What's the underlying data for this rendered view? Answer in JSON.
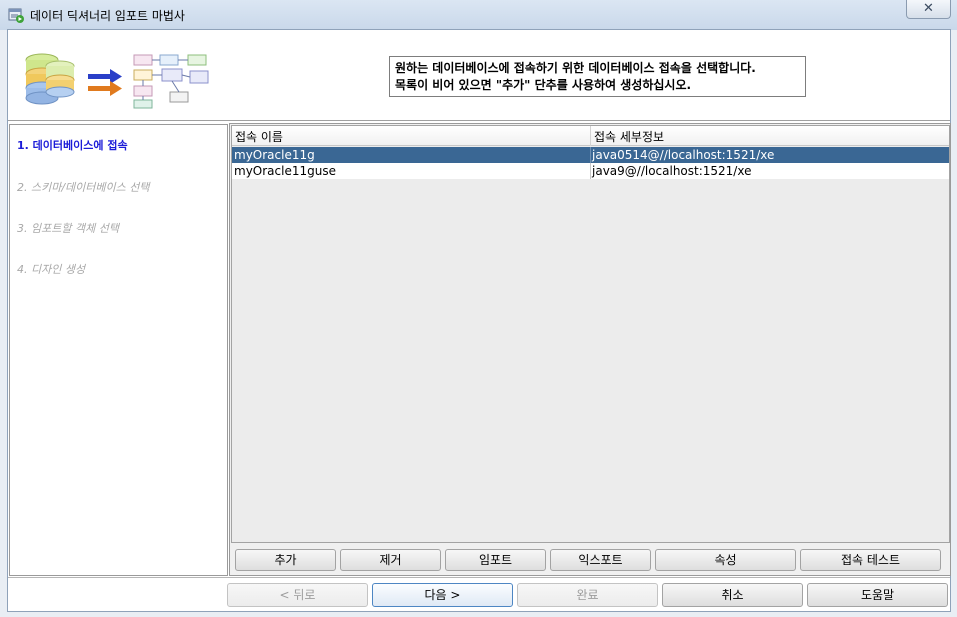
{
  "window": {
    "title": "데이터 딕셔너리 임포트 마법사",
    "close_glyph": "✕"
  },
  "header": {
    "message_line1": "원하는 데이터베이스에 접속하기 위한 데이터베이스 접속을 선택합니다.",
    "message_line2": "목록이 비어 있으면 \"추가\" 단추를 사용하여 생성하십시오."
  },
  "steps": [
    {
      "label": "1. 데이터베이스에 접속",
      "state": "active"
    },
    {
      "label": "2. 스키마/데이터베이스 선택",
      "state": "disabled"
    },
    {
      "label": "3. 임포트할 객체 선택",
      "state": "disabled"
    },
    {
      "label": "4. 디자인 생성",
      "state": "disabled"
    }
  ],
  "table": {
    "columns": [
      "접속 이름",
      "접속 세부정보"
    ],
    "rows": [
      {
        "name": "myOracle11g",
        "details": "java0514@//localhost:1521/xe",
        "selected": true
      },
      {
        "name": "myOracle11guse",
        "details": "java9@//localhost:1521/xe",
        "selected": false
      }
    ]
  },
  "table_buttons": {
    "add": "추가",
    "remove": "제거",
    "import": "임포트",
    "export": "익스포트",
    "properties": "속성",
    "test_connection": "접속 테스트"
  },
  "nav_buttons": {
    "back": "< 뒤로",
    "next": "다음 >",
    "finish": "완료",
    "cancel": "취소",
    "help": "도움말"
  },
  "colors": {
    "selected_row": "#3a6794",
    "active_step": "#1b1bd8",
    "disabled_text": "#a8a8a8"
  }
}
